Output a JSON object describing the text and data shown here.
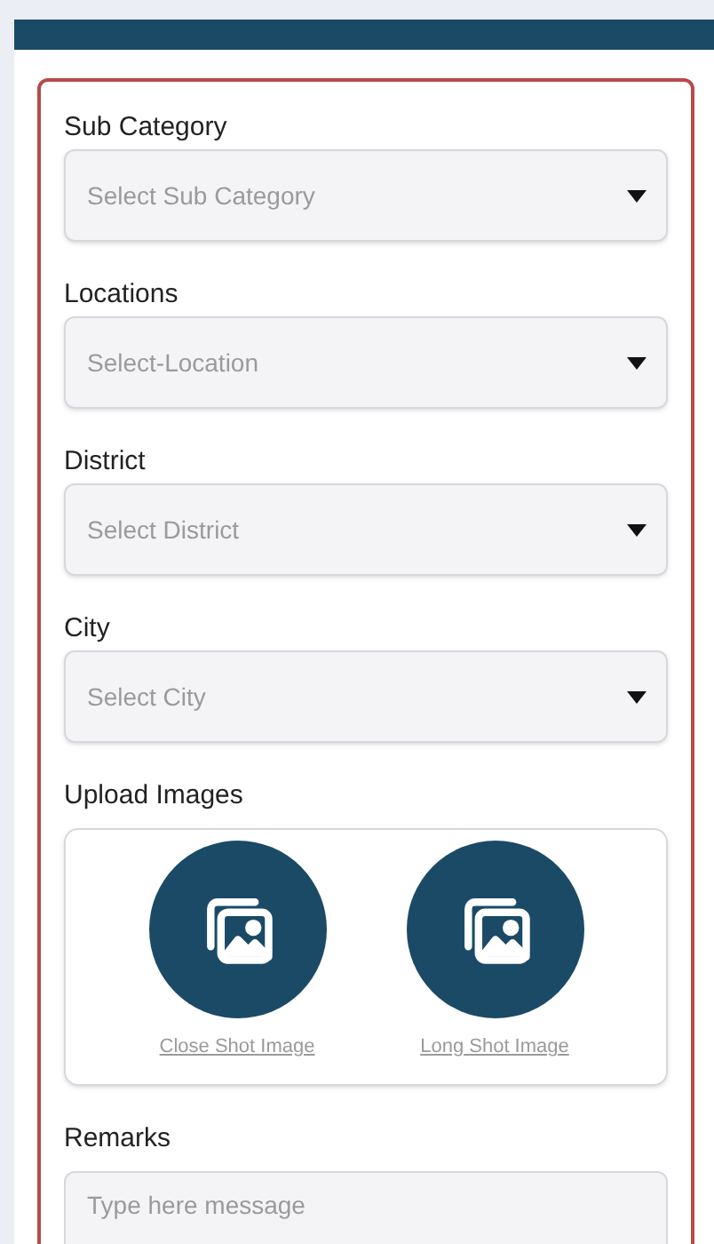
{
  "fields": [
    {
      "kind": "select",
      "label": "Sub Category",
      "placeholder": "Select Sub Category"
    },
    {
      "kind": "select",
      "label": "Locations",
      "placeholder": "Select-Location"
    },
    {
      "kind": "select",
      "label": "District",
      "placeholder": "Select District"
    },
    {
      "kind": "select",
      "label": "City",
      "placeholder": "Select City"
    },
    {
      "kind": "uploads",
      "label": "Upload Images",
      "items": [
        {
          "label": "Close Shot Image"
        },
        {
          "label": "Long Shot Image"
        }
      ]
    },
    {
      "kind": "textarea",
      "label": "Remarks",
      "placeholder": "Type here message"
    }
  ]
}
